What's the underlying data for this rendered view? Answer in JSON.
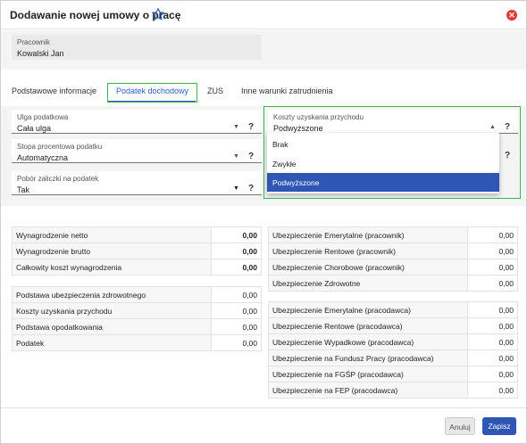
{
  "dialog": {
    "title": "Dodawanie nowej umowy o pracę"
  },
  "employee": {
    "label": "Pracownik",
    "value": "Kowalski Jan"
  },
  "tabs": [
    {
      "label": "Podstawowe informacje"
    },
    {
      "label": "Podatek dochodowy"
    },
    {
      "label": "ZUS"
    },
    {
      "label": "Inne warunki zatrudnienia"
    }
  ],
  "tax": {
    "ulga": {
      "label": "Ulga podatkowa",
      "value": "Cała ulga"
    },
    "stopa": {
      "label": "Stopa procentowa podatku",
      "value": "Automatyczna"
    },
    "pobor": {
      "label": "Pobór zaliczki na podatek",
      "value": "Tak"
    },
    "koszty": {
      "label": "Koszty uzyskania przychodu",
      "value": "Podwyższone"
    },
    "help": "?",
    "dropdown_options": [
      "Brak",
      "Zwykłe",
      "Podwyższone"
    ]
  },
  "summary_left_top": [
    {
      "label": "Wynagrodzenie netto",
      "value": "0,00"
    },
    {
      "label": "Wynagrodzenie brutto",
      "value": "0,00"
    },
    {
      "label": "Całkowity koszt wynagrodzenia",
      "value": "0,00"
    }
  ],
  "summary_left_bottom": [
    {
      "label": "Podstawa ubezpieczenia zdrowotnego",
      "value": "0,00"
    },
    {
      "label": "Koszty uzyskania przychodu",
      "value": "0,00"
    },
    {
      "label": "Podstawa opodatkowania",
      "value": "0,00"
    },
    {
      "label": "Podatek",
      "value": "0,00"
    }
  ],
  "summary_right_top": [
    {
      "label": "Ubezpieczenie Emerytalne (pracownik)",
      "value": "0,00"
    },
    {
      "label": "Ubezpieczenie Rentowe (pracownik)",
      "value": "0,00"
    },
    {
      "label": "Ubezpieczenie Chorobowe (pracownik)",
      "value": "0,00"
    },
    {
      "label": "Ubezpieczenie Zdrowotne",
      "value": "0,00"
    }
  ],
  "summary_right_bottom": [
    {
      "label": "Ubezpieczenie Emerytalne (pracodawca)",
      "value": "0,00"
    },
    {
      "label": "Ubezpieczenie Rentowe (pracodawca)",
      "value": "0,00"
    },
    {
      "label": "Ubezpieczenie Wypadkowe (pracodawca)",
      "value": "0,00"
    },
    {
      "label": "Ubezpieczenie na Fundusz Pracy (pracodawca)",
      "value": "0,00"
    },
    {
      "label": "Ubezpieczenie na FGŚP (pracodawca)",
      "value": "0,00"
    },
    {
      "label": "Ubezpieczenie na FEP (pracodawca)",
      "value": "0,00"
    }
  ],
  "footer": {
    "cancel_label": "Anuluj",
    "save_label": "Zapisz"
  },
  "colors": {
    "accent": "#2f56b4",
    "highlight": "#3ab54a",
    "close": "#e53935"
  }
}
